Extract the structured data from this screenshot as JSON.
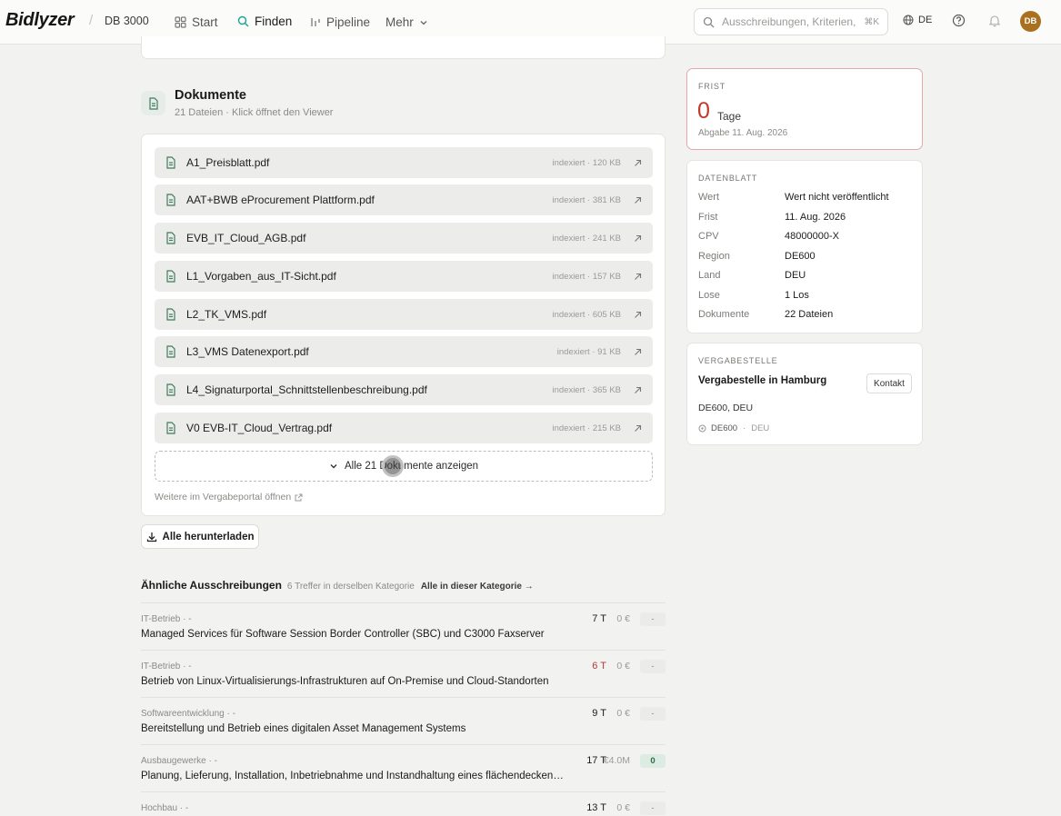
{
  "header": {
    "logo": "Bidlyzer",
    "workspace": "DB 3000",
    "nav": [
      {
        "label": "Start",
        "icon": "grid-icon"
      },
      {
        "label": "Finden",
        "icon": "search-icon",
        "active": true
      },
      {
        "label": "Pipeline",
        "icon": "pipeline-icon"
      },
      {
        "label": "Mehr",
        "icon": "chevron-down-icon"
      }
    ],
    "search_placeholder": "Ausschreibungen, Kriterien,",
    "search_shortcut": "⌘K",
    "language": "DE",
    "avatar_initials": "DB"
  },
  "documents": {
    "title": "Dokumente",
    "subtitle": "21 Dateien · Klick öffnet den Viewer",
    "files": [
      {
        "name": "A1_Preisblatt.pdf",
        "meta": "indexiert · 120 KB"
      },
      {
        "name": "AAT+BWB eProcurement Plattform.pdf",
        "meta": "indexiert · 381 KB"
      },
      {
        "name": "EVB_IT_Cloud_AGB.pdf",
        "meta": "indexiert · 241 KB"
      },
      {
        "name": "L1_Vorgaben_aus_IT-Sicht.pdf",
        "meta": "indexiert · 157 KB"
      },
      {
        "name": "L2_TK_VMS.pdf",
        "meta": "indexiert · 605 KB"
      },
      {
        "name": "L3_VMS Datenexport.pdf",
        "meta": "indexiert · 91 KB"
      },
      {
        "name": "L4_Signaturportal_Schnittstellenbeschreibung.pdf",
        "meta": "indexiert · 365 KB"
      },
      {
        "name": "V0 EVB-IT_Cloud_Vertrag.pdf",
        "meta": "indexiert · 215 KB"
      }
    ],
    "show_all_label": "Alle 21 Dokumente anzeigen",
    "more_link": "Weitere im Vergabeportal öffnen",
    "download_all_label": "Alle herunterladen"
  },
  "similar": {
    "title": "Ähnliche Ausschreibungen",
    "count": "6 Treffer in derselben Kategorie",
    "link": "Alle in dieser Kategorie →",
    "items": [
      {
        "category": "IT-Betrieb · -",
        "name": "Managed Services für Software Session Border Controller (SBC) und C3000 Faxserver",
        "days": "7 T",
        "value": "0 €",
        "badge": "-"
      },
      {
        "category": "IT-Betrieb · -",
        "name": "Betrieb von Linux-Virtualisierungs-Infrastrukturen auf On-Premise und Cloud-Standorten",
        "days": "6 T",
        "value": "0 €",
        "badge": "-"
      },
      {
        "category": "Softwareentwicklung · -",
        "name": "Bereitstellung und Betrieb eines digitalen Asset Management Systems",
        "days": "9 T",
        "value": "0 €",
        "badge": "-"
      },
      {
        "category": "Ausbaugewerke · -",
        "name": "Planung, Lieferung, Installation, Inbetriebnahme und Instandhaltung eines flächendeckenden v...",
        "days": "17 T",
        "value": "€4.0M",
        "badge": "0"
      },
      {
        "category": "Hochbau · -",
        "name": "",
        "days": "13 T",
        "value": "0 €",
        "badge": "-"
      }
    ]
  },
  "deadline": {
    "label": "Frist",
    "number": "0",
    "unit": "Tage",
    "date": "Abgabe 11. Aug. 2026"
  },
  "datasheet": {
    "label": "Datenblatt",
    "rows": [
      {
        "key": "Wert",
        "value": "Wert nicht veröffentlicht"
      },
      {
        "key": "Frist",
        "value": "11. Aug. 2026"
      },
      {
        "key": "CPV",
        "value": "48000000-X"
      },
      {
        "key": "Region",
        "value": "DE600"
      },
      {
        "key": "Land",
        "value": "DEU"
      },
      {
        "key": "Lose",
        "value": "1 Los"
      },
      {
        "key": "Dokumente",
        "value": "22 Dateien"
      }
    ]
  },
  "authority": {
    "label": "Vergabestelle",
    "name": "Vergabestelle in Hamburg",
    "contact_label": "Kontakt",
    "address": "DE600, DEU",
    "tag_region": "DE600",
    "tag_country": "DEU"
  },
  "colors": {
    "accent": "#16a58f",
    "deadline_red": "#c0392b",
    "avatar": "#a8701f"
  }
}
